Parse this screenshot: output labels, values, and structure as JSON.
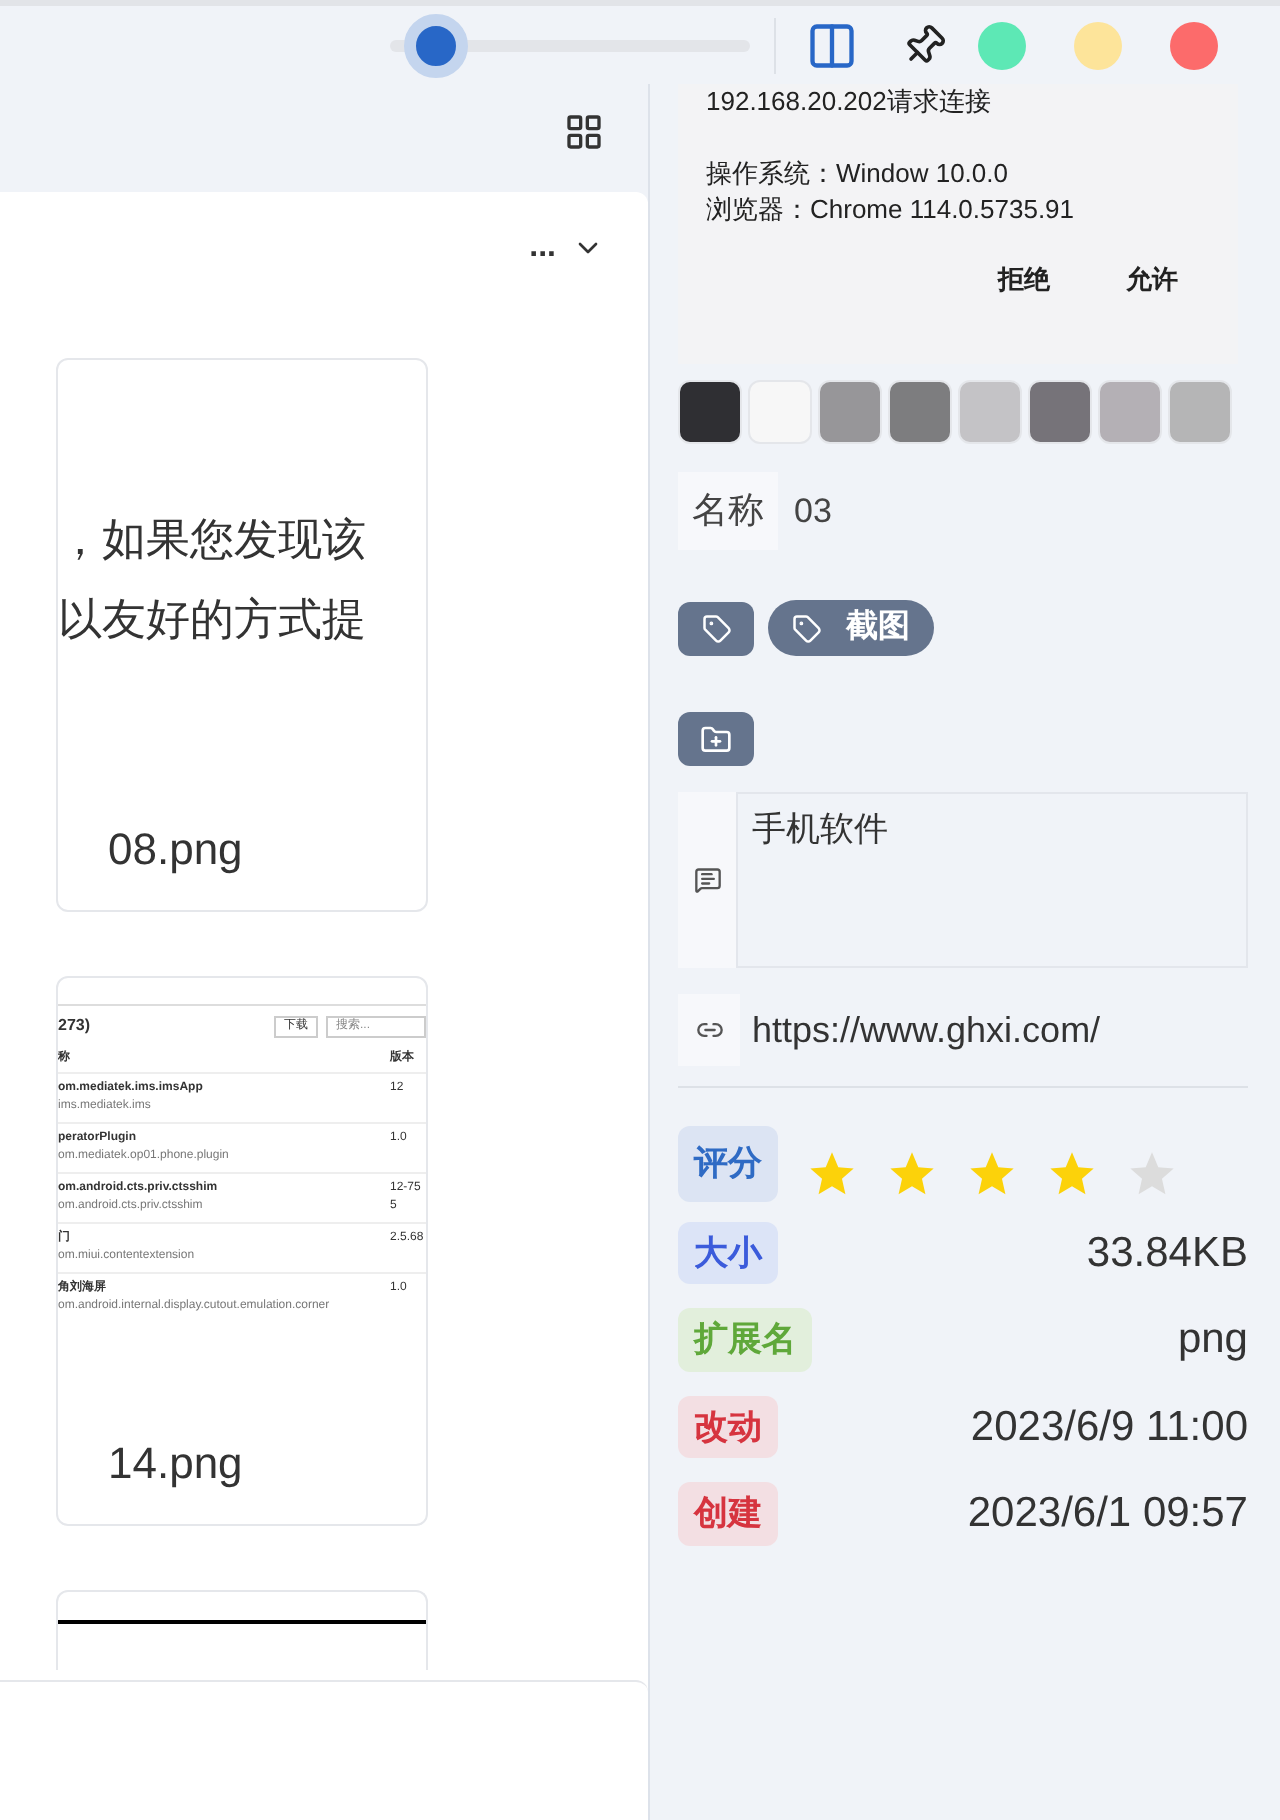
{
  "toolbar": {
    "zoom_slider": {
      "level": 0.05
    },
    "menu_button": "...",
    "window_dots": [
      {
        "color": "#5de8b5"
      },
      {
        "color": "#fde49a"
      },
      {
        "color": "#fc6b6b"
      }
    ]
  },
  "thumbnails": [
    {
      "kind": "text",
      "lines": [
        "，如果您发现该",
        "以友好的方式提"
      ],
      "name": "08.png"
    },
    {
      "kind": "table",
      "header": "273)",
      "download": "下载",
      "search": "搜索...",
      "col_name": "称",
      "col_version": "版本",
      "rows": [
        {
          "title": "om.mediatek.ims.imsApp",
          "sub": "ims.mediatek.ims",
          "ver": "12"
        },
        {
          "title": "peratorPlugin",
          "sub": "om.mediatek.op01.phone.plugin",
          "ver": "1.0"
        },
        {
          "title": "om.android.cts.priv.ctsshim",
          "sub": "om.android.cts.priv.ctsshim",
          "ver": "12-755"
        },
        {
          "title": "门",
          "sub": "om.miui.contentextension",
          "ver": "2.5.68"
        },
        {
          "title": "角刘海屏",
          "sub": "om.android.internal.display.cutout.emulation.corner",
          "ver": "1.0"
        }
      ],
      "name": "14.png"
    },
    {
      "kind": "blank"
    }
  ],
  "preview": {
    "lines": [
      "192.168.20.202请求连接",
      "操作系统：Window 10.0.0",
      "浏览器：Chrome 114.0.5735.91"
    ],
    "buttons": [
      "拒绝",
      "允许"
    ]
  },
  "palette": [
    {
      "color": "#2f2f33"
    },
    {
      "color": "#f7f7f7"
    },
    {
      "color": "#979699"
    },
    {
      "color": "#7d7d7f"
    },
    {
      "color": "#c4c3c6"
    },
    {
      "color": "#767379"
    },
    {
      "color": "#b4b0b5"
    },
    {
      "color": "#b5b5b6"
    }
  ],
  "name_field": {
    "label": "名称",
    "value": "03"
  },
  "tags": [
    "截图"
  ],
  "note": {
    "value": "手机软件"
  },
  "link": {
    "value": "https://www.ghxi.com/"
  },
  "rating": {
    "label": "评分",
    "stars": 4
  },
  "properties": [
    {
      "label": "大小",
      "value": "33.84KB",
      "color": "#3b5bdb"
    },
    {
      "label": "扩展名",
      "value": "png",
      "color": "#5fa83a"
    },
    {
      "label": "改动",
      "value": "2023/6/9 11:00",
      "color": "#d6343f"
    },
    {
      "label": "创建",
      "value": "2023/6/1 09:57",
      "color": "#d6343f"
    }
  ]
}
